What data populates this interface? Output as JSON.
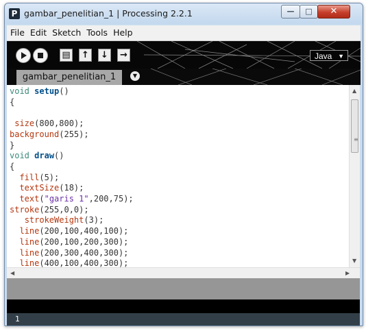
{
  "window": {
    "app_icon": "P",
    "title": "gambar_penelitian_1 | Processing 2.2.1",
    "controls": {
      "minimize": "minimize-icon",
      "maximize": "maximize-icon",
      "close": "close-icon"
    }
  },
  "menubar": {
    "items": [
      "File",
      "Edit",
      "Sketch",
      "Tools",
      "Help"
    ]
  },
  "toolbar": {
    "buttons": [
      "run-icon",
      "stop-icon",
      "new-icon",
      "open-icon",
      "save-icon",
      "export-icon"
    ],
    "mode_label": "Java",
    "mode_arrow": "▼"
  },
  "tabs": {
    "active": "gambar_penelitian_1",
    "menu_icon": "chevron-down-icon"
  },
  "editor": {
    "lines": [
      "void setup()",
      "{",
      "",
      " size(800,800);",
      "background(255);",
      "}",
      "void draw()",
      "{",
      "  fill(5);",
      "  textSize(18);",
      "  text(\"garis 1\",200,75);",
      "stroke(255,0,0);",
      "   strokeWeight(3);",
      "  line(200,100,400,100);",
      "  line(200,100,200,300);",
      "  line(200,300,400,300);",
      "  line(400,100,400,300);"
    ]
  },
  "status": {
    "line_number": "1"
  },
  "colors": {
    "toolbar_bg": "#070707",
    "tab_active": "#a8a8a8",
    "message_area": "#969696",
    "console_bg": "#000000",
    "status_bg": "#333f48"
  }
}
